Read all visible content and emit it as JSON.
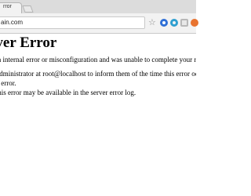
{
  "browser": {
    "tab": {
      "title": "rror",
      "close_icon": "×"
    },
    "new_tab_icon": "new-tab-icon",
    "address_bar": {
      "value": "ain.com"
    },
    "toolbar_icons": [
      "star-icon",
      "extension-icon-blue",
      "extension-icon-teal",
      "extension-icon-gray",
      "extension-icon-orange"
    ],
    "star_glyph": "☆"
  },
  "page": {
    "heading": "rver Error",
    "paragraph_1": "d an internal error or misconfiguration and was unable to complete your request.",
    "paragraph_2_line_1": "er administrator at root@localhost to inform them of the time this error occurred,",
    "paragraph_2_line_2": "this error.",
    "paragraph_3": "at this error may be available in the server error log."
  },
  "colors": {
    "tabstrip": "#dcdcdc",
    "toolbar": "#f2f2f2",
    "page_background": "#ffffff",
    "text": "#000000"
  }
}
